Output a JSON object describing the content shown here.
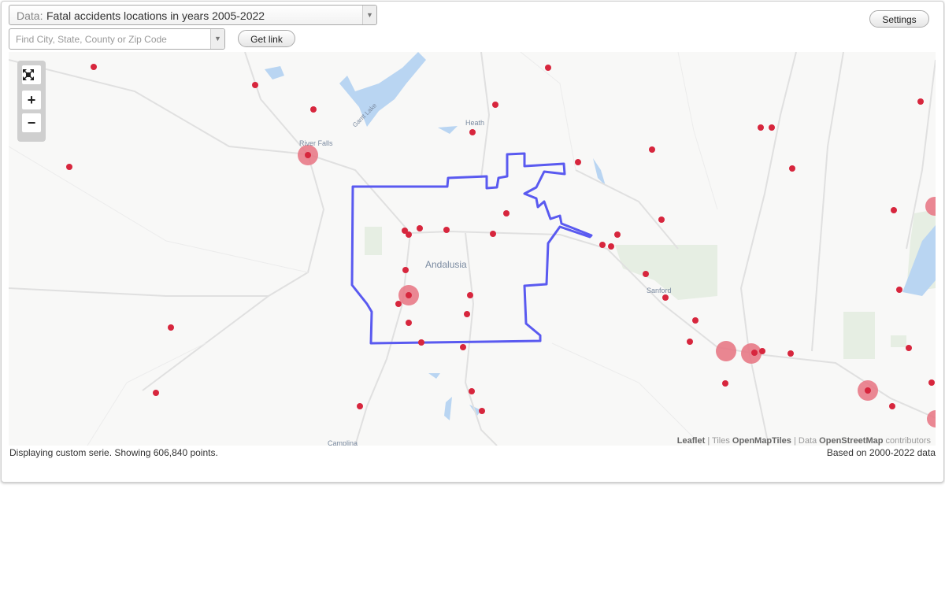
{
  "data_select": {
    "prefix": "Data:",
    "value": "Fatal accidents locations in years 2005-2022"
  },
  "search": {
    "placeholder": "Find City, State, County or Zip Code"
  },
  "buttons": {
    "get_link": "Get link",
    "settings": "Settings"
  },
  "zoom": {
    "fullscreen_icon": "fullscreen-icon",
    "zoom_in": "+",
    "zoom_out": "−"
  },
  "map_labels": {
    "andalusia": "Andalusia",
    "river_falls": "River Falls",
    "heath": "Heath",
    "sanford": "Sanford",
    "gantt_lake": "Gantt Lake",
    "camplina": "Camplina"
  },
  "attribution": {
    "leaflet": "Leaflet",
    "sep1": " | Tiles ",
    "tiles": "OpenMapTiles",
    "sep2": " | Data ",
    "data": "OpenStreetMap",
    "contrib": " contributors"
  },
  "status": {
    "left": "Displaying custom serie. Showing 606,840 points.",
    "right": "Based on 2000-2022 data"
  },
  "colors": {
    "point": "#d7263d",
    "cluster": "#e87a87",
    "boundary": "#5a5af0",
    "water": "#b9d5f2",
    "road": "#dedede",
    "park": "#e8efe6"
  }
}
